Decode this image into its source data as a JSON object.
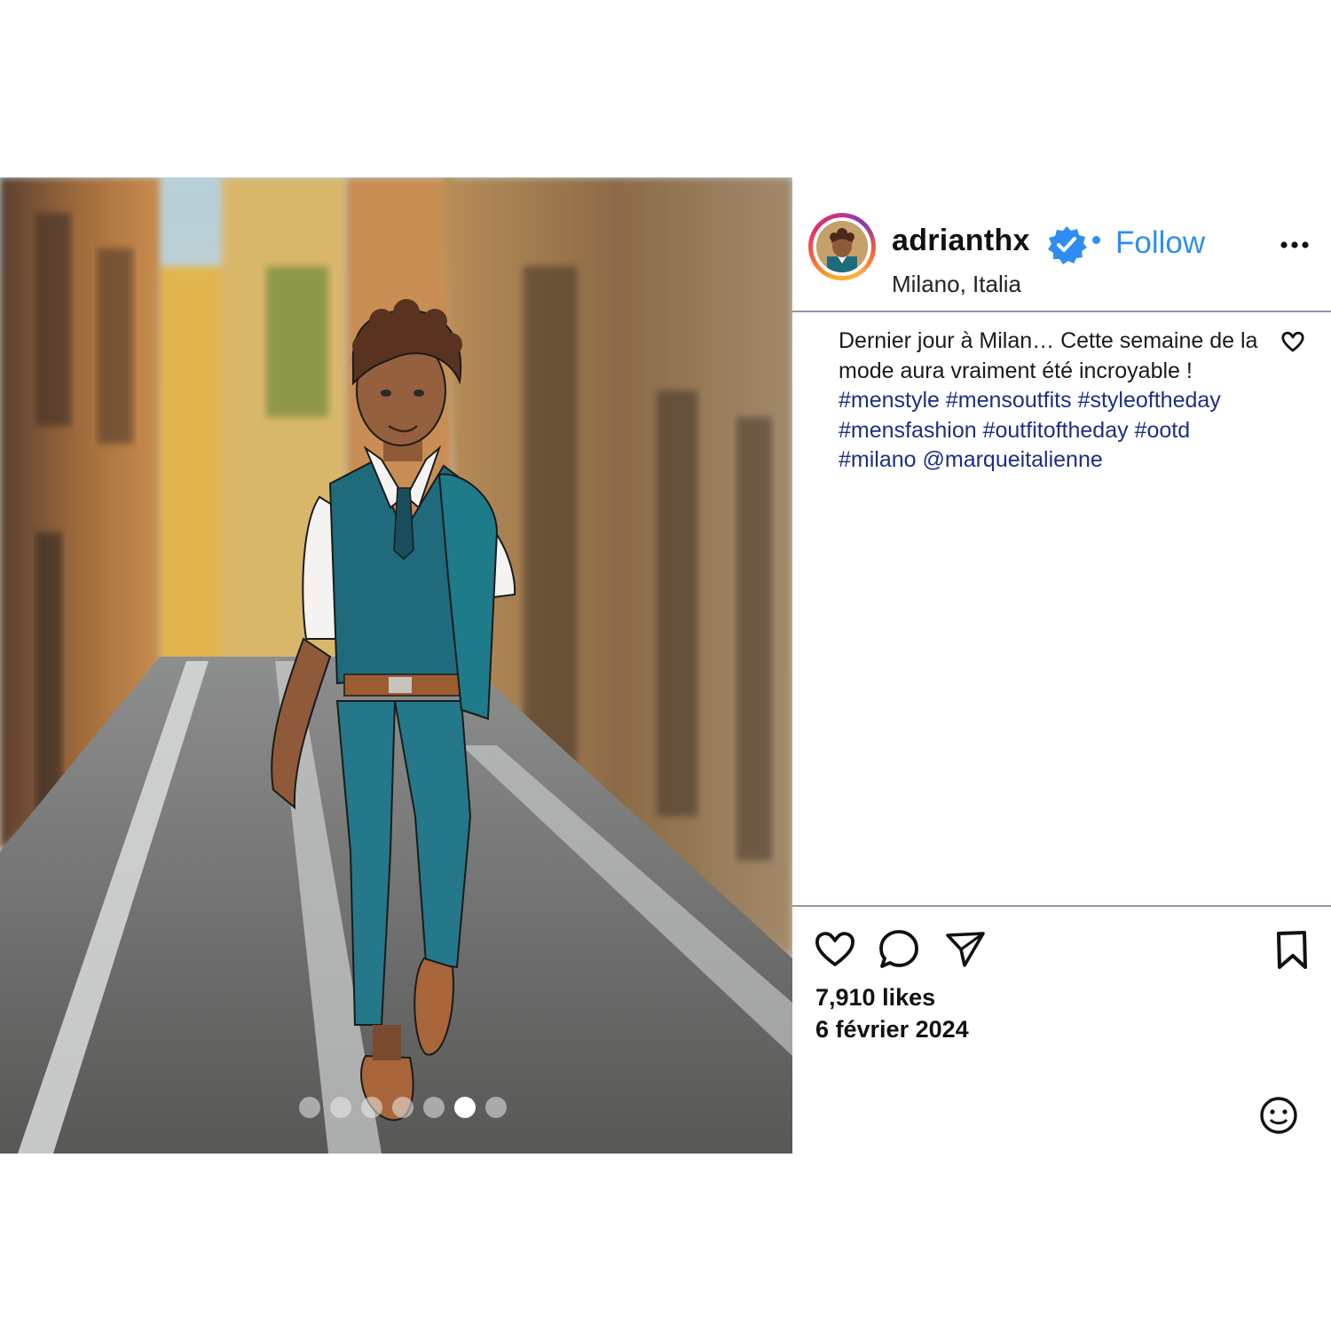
{
  "post": {
    "username": "adrianthx",
    "follow_label": "Follow",
    "location": "Milano, Italia",
    "caption_text": "Dernier jour à Milan… Cette semaine de la mode aura vraiment été incroyable !",
    "caption_tags": "#menstyle #mensoutfits #styleoftheday #mensfashion #outfitoftheday #ootd #milano @marqueitalienne",
    "likes": "7,910 likes",
    "date": "6 février 2024"
  },
  "carousel": {
    "total": 7,
    "active_index": 5
  },
  "icons": {
    "header": [
      "verified-badge-icon",
      "more-options-icon"
    ],
    "caption": [
      "caption-like-heart-icon"
    ],
    "actions": [
      "like-heart-icon",
      "comment-bubble-icon",
      "share-send-icon",
      "bookmark-icon"
    ],
    "footer": [
      "emoji-smiley-icon"
    ]
  },
  "colors": {
    "accent_blue": "#2f8df2",
    "hashtag_navy": "#1c2f86",
    "divider": "#8e96ae",
    "outfit_teal": "#1e6475"
  }
}
